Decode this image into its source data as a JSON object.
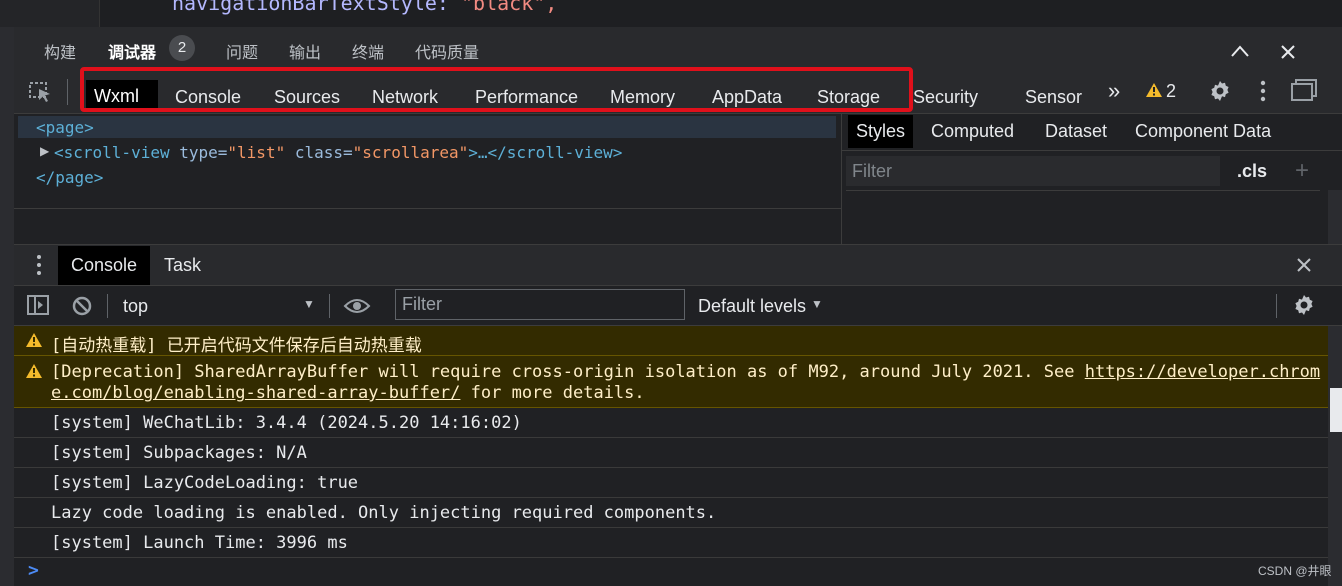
{
  "code": {
    "key_text": "navigationBarTextStyle",
    "sep": ": ",
    "value_text": "\"black\","
  },
  "ide_tabs": [
    {
      "label": "构建"
    },
    {
      "label": "调试器"
    },
    {
      "label": "问题"
    },
    {
      "label": "输出"
    },
    {
      "label": "终端"
    },
    {
      "label": "代码质量"
    }
  ],
  "debugger_badge": "2",
  "devtools_tabs": [
    {
      "label": "Wxml"
    },
    {
      "label": "Console"
    },
    {
      "label": "Sources"
    },
    {
      "label": "Network"
    },
    {
      "label": "Performance"
    },
    {
      "label": "Memory"
    },
    {
      "label": "AppData"
    },
    {
      "label": "Storage"
    },
    {
      "label": "Security"
    },
    {
      "label": "Sensor"
    }
  ],
  "more_tabs_glyph": "»",
  "warning_count": "2",
  "elements": {
    "page_open": "<page>",
    "scroll_tag_open": "<scroll-view",
    "attr1_name": "type",
    "attr1_value": "\"list\"",
    "attr2_name": "class",
    "attr2_value": "\"scrollarea\"",
    "scroll_rest": ">…</scroll-view>",
    "page_close": "</page>"
  },
  "style_tabs": [
    {
      "label": "Styles"
    },
    {
      "label": "Computed"
    },
    {
      "label": "Dataset"
    },
    {
      "label": "Component Data"
    }
  ],
  "style_filter": {
    "placeholder": "Filter",
    "cls_label": ".cls",
    "plus": "+"
  },
  "drawer_tabs": [
    {
      "label": "Console"
    },
    {
      "label": "Task"
    }
  ],
  "console_toolbar": {
    "context": "top",
    "filter_placeholder": "Filter",
    "levels": "Default levels"
  },
  "messages": [
    {
      "level": "warning",
      "text": "[自动热重载] 已开启代码文件保存后自动热重载"
    },
    {
      "level": "warning",
      "text_before": "[Deprecation] SharedArrayBuffer will require cross-origin isolation as of M92, around July 2021. See ",
      "link_line1": "https://developer.chrom",
      "link_line2": "e.com/blog/enabling-shared-array-buffer/",
      "text_after": " for more details."
    },
    {
      "level": "info",
      "text": "[system] WeChatLib: 3.4.4 (2024.5.20 14:16:02)"
    },
    {
      "level": "info",
      "text": "[system] Subpackages: N/A"
    },
    {
      "level": "info",
      "text": "[system] LazyCodeLoading: true"
    },
    {
      "level": "info",
      "text": "Lazy code loading is enabled. Only injecting required components."
    },
    {
      "level": "info",
      "text": "[system] Launch Time: 3996 ms"
    }
  ],
  "prompt_glyph": ">",
  "watermark": "CSDN @井眼",
  "colors": {
    "highlight_box": "#e0101b",
    "warning_bg": "#332b00",
    "warning_icon": "#f4bb2c",
    "tag": "#5db0d7",
    "attr_value": "#f29766"
  }
}
